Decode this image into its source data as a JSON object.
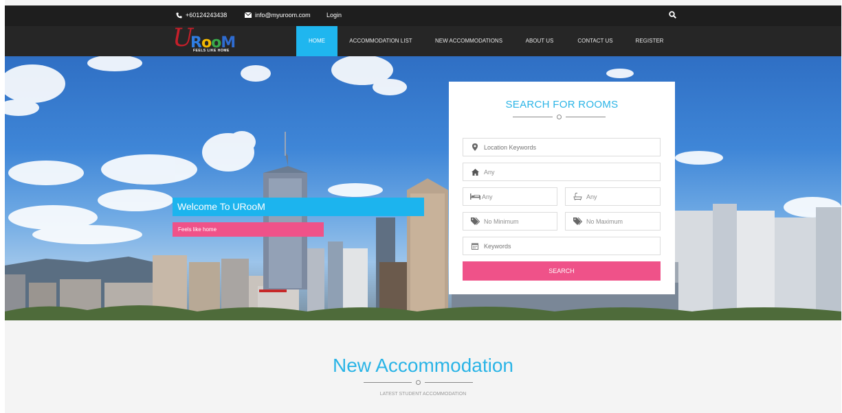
{
  "topbar": {
    "phone": "+60124243438",
    "email": "info@myuroom.com",
    "login": "Login",
    "icons": {
      "phone": "phone-icon",
      "email": "envelope-icon",
      "search": "search-icon"
    }
  },
  "logo": {
    "letter_u": "U",
    "letters": [
      "R",
      "o",
      "o",
      "M"
    ],
    "letter_colors": [
      "#2f7de1",
      "#f2b800",
      "#3aa84a",
      "#2f6cd0"
    ],
    "u_color": "#c61f2a",
    "tagline": "FEELS LIKE HOME"
  },
  "nav": {
    "items": [
      {
        "label": "HOME",
        "active": true
      },
      {
        "label": "ACCOMMODATION LIST",
        "active": false
      },
      {
        "label": "NEW ACCOMMODATIONS",
        "active": false
      },
      {
        "label": "ABOUT US",
        "active": false
      },
      {
        "label": "CONTACT US",
        "active": false
      },
      {
        "label": "REGISTER",
        "active": false
      }
    ]
  },
  "hero": {
    "welcome": "Welcome To URooM",
    "tagline": "Feels like home"
  },
  "search": {
    "title": "SEARCH FOR ROOMS",
    "location_placeholder": "Location Keywords",
    "type_value": "Any",
    "bedrooms_value": "Any",
    "bathrooms_value": "Any",
    "min_price_value": "No Minimum",
    "max_price_value": "No Maximum",
    "keywords_placeholder": "Keywords",
    "button_label": "SEARCH",
    "icons": [
      "map-marker-icon",
      "home-icon",
      "bed-icon",
      "bath-icon",
      "tag-icon",
      "tag-icon",
      "calendar-icon"
    ]
  },
  "section": {
    "title": "New Accommodation",
    "subtitle": "LATEST STUDENT ACCOMMODATION"
  },
  "colors": {
    "accent_blue": "#1fb6ef",
    "accent_pink": "#ef5289",
    "topbar_bg": "#1e1e1e",
    "navbar_bg": "#262626"
  }
}
